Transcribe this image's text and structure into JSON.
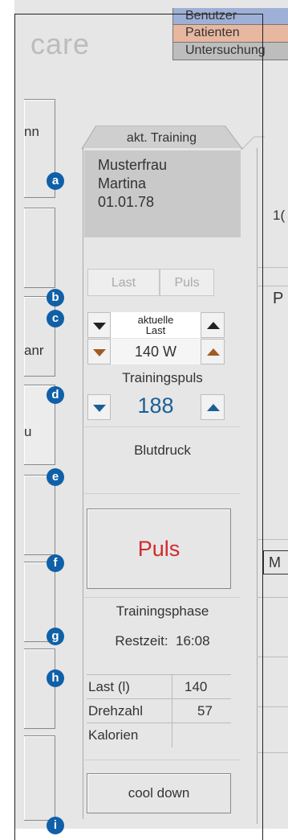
{
  "app": {
    "logo": "care"
  },
  "header": {
    "buttons": [
      {
        "label": "Benutzer",
        "color": "#9fb0d6"
      },
      {
        "label": "Patienten",
        "color": "#e8b79f"
      },
      {
        "label": "Untersuchung",
        "color": "#bdbdbd"
      }
    ]
  },
  "left_buttons": {
    "a": "nn",
    "c": "anr",
    "d": "u"
  },
  "right_fragments": {
    "number": "1(",
    "letter_p": "P",
    "letter_m": "M"
  },
  "training_tab": {
    "label": "akt. Training"
  },
  "patient": {
    "last_name": "Musterfrau",
    "first_name": "Martina",
    "birthdate": "01.01.78"
  },
  "toggle": {
    "last": "Last",
    "puls": "Puls"
  },
  "load": {
    "label_line1": "aktuelle",
    "label_line2": "Last",
    "value": "140 W"
  },
  "training_pulse": {
    "label": "Trainingspuls",
    "value": "188"
  },
  "blood_pressure": {
    "label": "Blutdruck"
  },
  "pulse_button": {
    "label": "Puls",
    "color": "#d22b2b"
  },
  "phase": {
    "label": "Trainingsphase",
    "remaining_label": "Restzeit:",
    "remaining_value": "16:08"
  },
  "stats": {
    "rows": [
      {
        "label": "Last (l)",
        "value": "140"
      },
      {
        "label": "Drehzahl",
        "value": "57"
      },
      {
        "label": "Kalorien",
        "value": ""
      }
    ]
  },
  "cool_down": {
    "label": "cool down"
  },
  "markers": [
    "a",
    "b",
    "c",
    "d",
    "e",
    "f",
    "g",
    "h",
    "i"
  ]
}
